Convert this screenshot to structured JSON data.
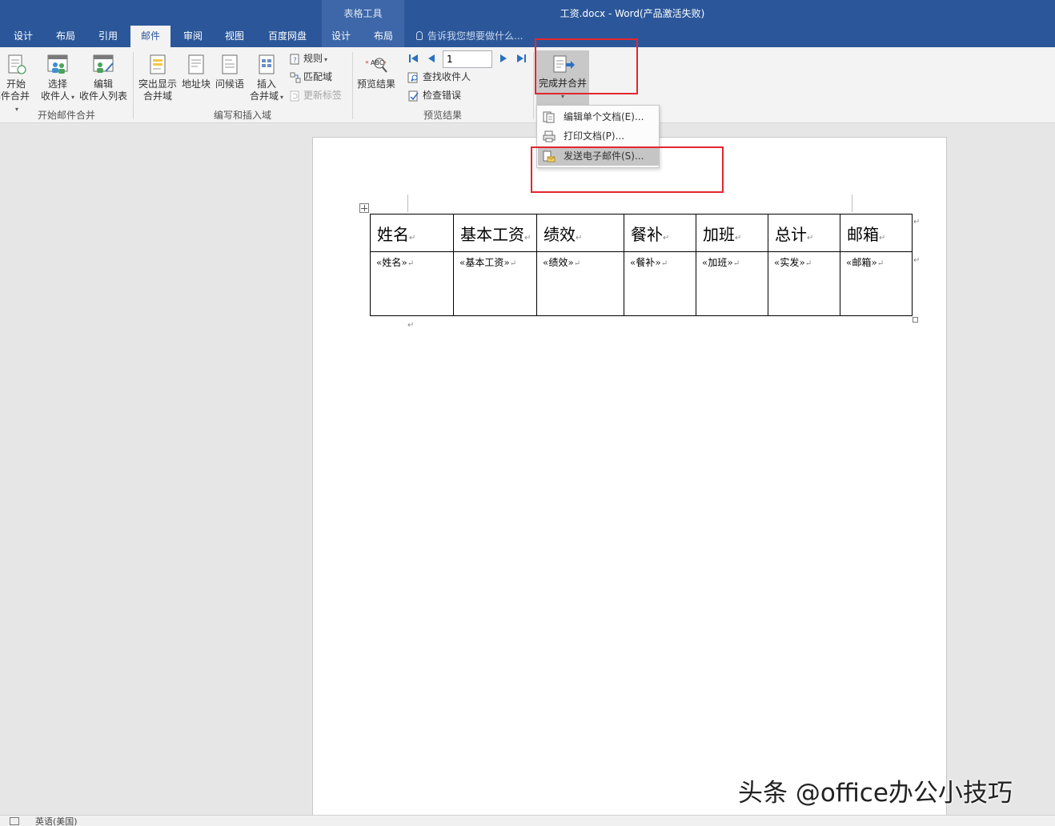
{
  "window": {
    "title": "工资.docx - Word(产品激活失败)",
    "context_group": "表格工具"
  },
  "tabs": [
    {
      "label": "设计",
      "active": false
    },
    {
      "label": "布局",
      "active": false
    },
    {
      "label": "引用",
      "active": false
    },
    {
      "label": "邮件",
      "active": true
    },
    {
      "label": "审阅",
      "active": false
    },
    {
      "label": "视图",
      "active": false
    },
    {
      "label": "百度网盘",
      "active": false
    },
    {
      "label": "设计",
      "active": false
    },
    {
      "label": "布局",
      "active": false
    }
  ],
  "tellme": {
    "placeholder": "告诉我您想要做什么..."
  },
  "ribbon": {
    "groups": {
      "start": "开始邮件合并",
      "write_insert": "编写和插入域",
      "preview": "预览结果"
    },
    "start_mail_merge": {
      "line1": "开始",
      "line2": "邮件合并"
    },
    "select_recipients": {
      "line1": "选择",
      "line2": "收件人"
    },
    "edit_recipients": {
      "line1": "编辑",
      "line2": "收件人列表"
    },
    "highlight_fields": {
      "line1": "突出显示",
      "line2": "合并域"
    },
    "address_block": "地址块",
    "greeting_line": "问候语",
    "insert_field": {
      "line1": "插入",
      "line2": "合并域"
    },
    "rules": "规则",
    "match_fields": "匹配域",
    "update_labels": "更新标签",
    "preview_results": "预览结果",
    "record_number": "1",
    "find_recipient": "查找收件人",
    "check_errors": "检查错误",
    "finish_merge": "完成并合并"
  },
  "finish_menu": {
    "items": [
      {
        "label": "编辑单个文档(E)...",
        "hover": false
      },
      {
        "label": "打印文档(P)...",
        "hover": false
      },
      {
        "label": "发送电子邮件(S)...",
        "hover": true
      }
    ]
  },
  "table": {
    "headers": [
      "姓名",
      "基本工资",
      "绩效",
      "餐补",
      "加班",
      "总计",
      "邮箱"
    ],
    "fields": [
      "«姓名»",
      "«基本工资»",
      "«绩效»",
      "«餐补»",
      "«加班»",
      "«实发»",
      "«邮箱»"
    ],
    "paragraph_mark": "↵"
  },
  "statusbar": {
    "language": "英语(美国)"
  },
  "watermark": "头条 @office办公小技巧",
  "colors": {
    "title_bar": "#2b579a",
    "highlight_box": "#e3262f",
    "ribbon": "#f3f3f3"
  }
}
